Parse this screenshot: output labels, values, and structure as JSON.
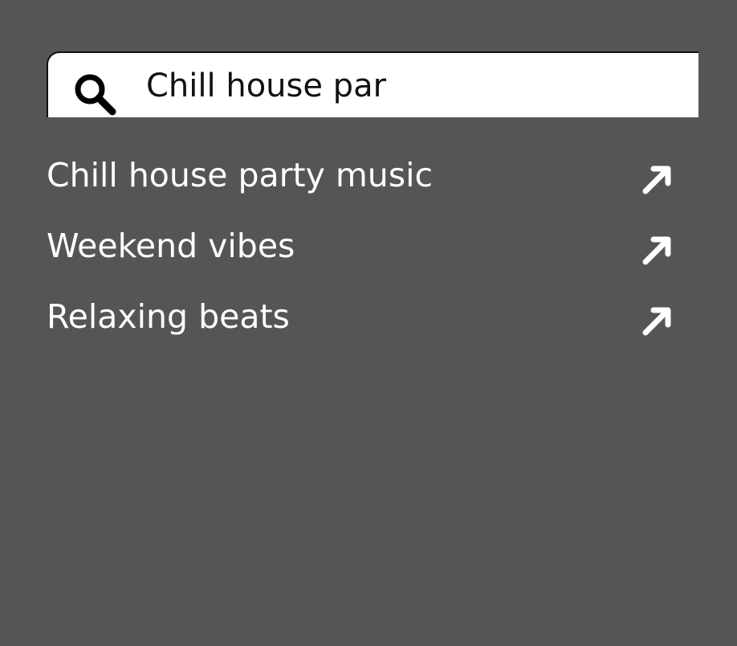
{
  "search": {
    "value": "Chill house par",
    "icon": "search-icon"
  },
  "suggestions": [
    {
      "label": "Chill house party music",
      "icon": "arrow-up-right-icon"
    },
    {
      "label": "Weekend vibes",
      "icon": "arrow-up-right-icon"
    },
    {
      "label": "Relaxing beats",
      "icon": "arrow-up-right-icon"
    }
  ],
  "colors": {
    "background": "#555555",
    "search_bg": "#ffffff",
    "text_light": "#ffffff",
    "text_dark": "#111111"
  }
}
